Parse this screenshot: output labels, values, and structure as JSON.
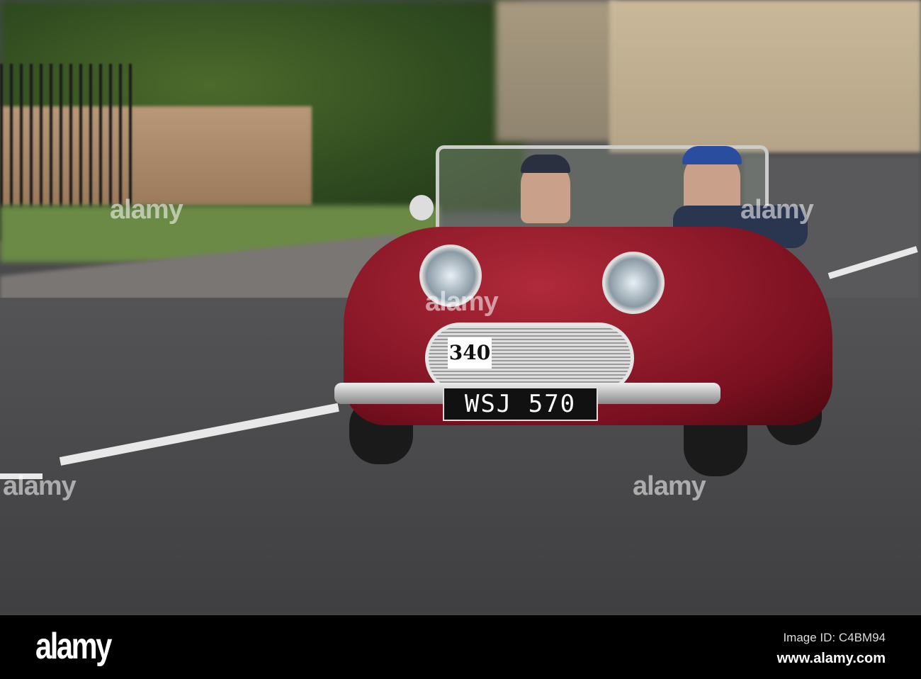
{
  "photo": {
    "subject": "red vintage convertible on road",
    "race_number": "340",
    "license_plate": "WSJ 570"
  },
  "watermark": "alamy",
  "footer": {
    "logo": "alamy",
    "image_id": "Image ID: C4BM94",
    "website": "www.alamy.com"
  }
}
